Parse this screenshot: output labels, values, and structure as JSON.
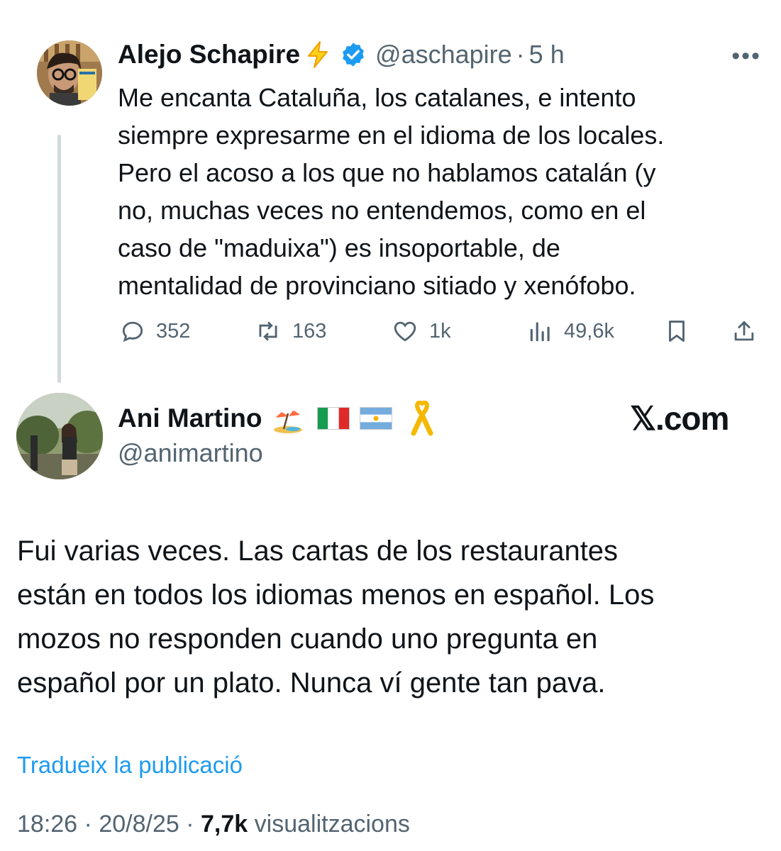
{
  "parent_tweet": {
    "display_name": "Alejo Schapire",
    "handle": "@aschapire",
    "separator": "·",
    "time_ago": "5 h",
    "more_label": "•••",
    "text": "Me encanta Cataluña, los catalanes, e intento\nsiempre expresarme en el idioma de los locales.\nPero el acoso a los que no hablamos catalán (y\nno, muchas veces no entendemos, como en el\ncaso de \"maduixa\") es insoportable, de\nmentalidad de provinciano sitiado y xenófobo.",
    "icons": {
      "badge": "lightning-bolt-icon",
      "verified": "verified-badge-icon"
    },
    "actions": {
      "replies": "352",
      "reposts": "163",
      "likes": "1k",
      "views": "49,6k"
    }
  },
  "reply_tweet": {
    "display_name": "Ani Martino",
    "handle": "@animartino",
    "emojis": [
      "beach-umbrella-icon",
      "italy-flag-icon",
      "argentina-flag-icon",
      "yellow-ribbon-icon"
    ],
    "watermark": "𝕏.com",
    "text": "Fui varias veces. Las cartas de los restaurantes\nestán en todos los idiomas menos en español. Los\nmozos no responden cuando uno pregunta en\nespañol por un plato. Nunca ví gente tan pava.",
    "translate_label": "Tradueix la publicació",
    "time": "18:26",
    "separator": "·",
    "date": "20/8/25",
    "views_count": "7,7k",
    "views_label": "visualitzacions"
  },
  "colors": {
    "text": "#0f1419",
    "secondary": "#536471",
    "accent": "#1d9bf0",
    "thread_line": "#cfd9de",
    "bolt": "#f5b800"
  }
}
